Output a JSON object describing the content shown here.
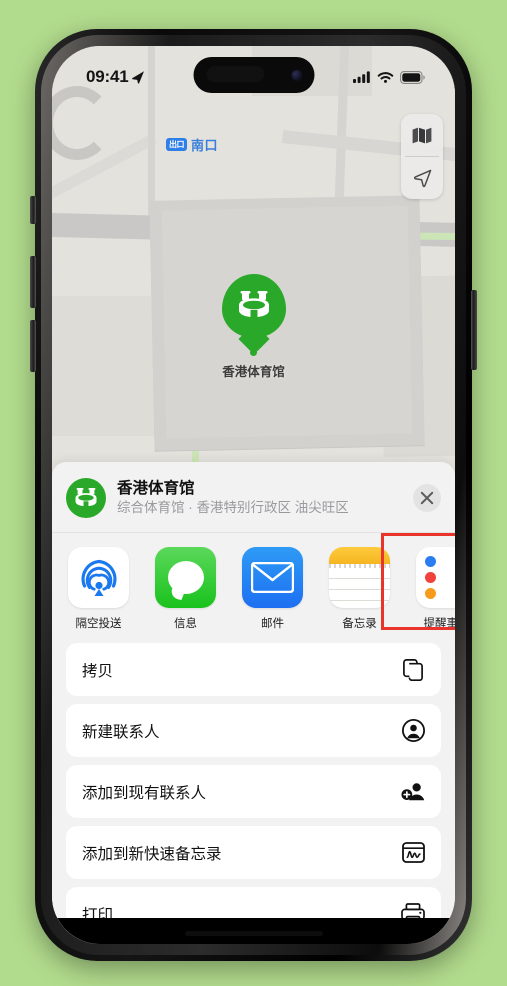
{
  "background_color": "#b2dc8d",
  "status_bar": {
    "time": "09:41",
    "location_arrow": "location-arrow-icon",
    "cellular": "signal-bars-icon",
    "wifi": "wifi-icon",
    "battery": "battery-icon"
  },
  "map": {
    "pin_label": "香港体育馆",
    "exit_badge_text": "出口",
    "exit_label": "南口",
    "pin_color": "#2aa829",
    "background_color": "#e4e2dd",
    "controls": [
      {
        "name": "map-layers-button",
        "icon": "map-icon"
      },
      {
        "name": "locate-me-button",
        "icon": "navigation-arrow-icon"
      }
    ]
  },
  "share_sheet": {
    "title": "香港体育馆",
    "subtitle": "综合体育馆 · 香港特别行政区 油尖旺区",
    "close_label": "✕",
    "apps": [
      {
        "label": "隔空投送",
        "icon": "airdrop-icon",
        "highlighted": false
      },
      {
        "label": "信息",
        "icon": "messages-icon",
        "highlighted": false
      },
      {
        "label": "邮件",
        "icon": "mail-icon",
        "highlighted": false
      },
      {
        "label": "备忘录",
        "icon": "notes-icon",
        "highlighted": true
      },
      {
        "label": "提醒事项",
        "icon": "reminders-icon",
        "highlighted": false
      }
    ],
    "highlight_color": "#e8342a",
    "actions": [
      {
        "label": "拷贝",
        "icon": "copy-icon"
      },
      {
        "label": "新建联系人",
        "icon": "person-circle-icon"
      },
      {
        "label": "添加到现有联系人",
        "icon": "person-badge-plus-icon"
      },
      {
        "label": "添加到新快速备忘录",
        "icon": "quick-note-icon"
      },
      {
        "label": "打印",
        "icon": "printer-icon"
      }
    ]
  }
}
